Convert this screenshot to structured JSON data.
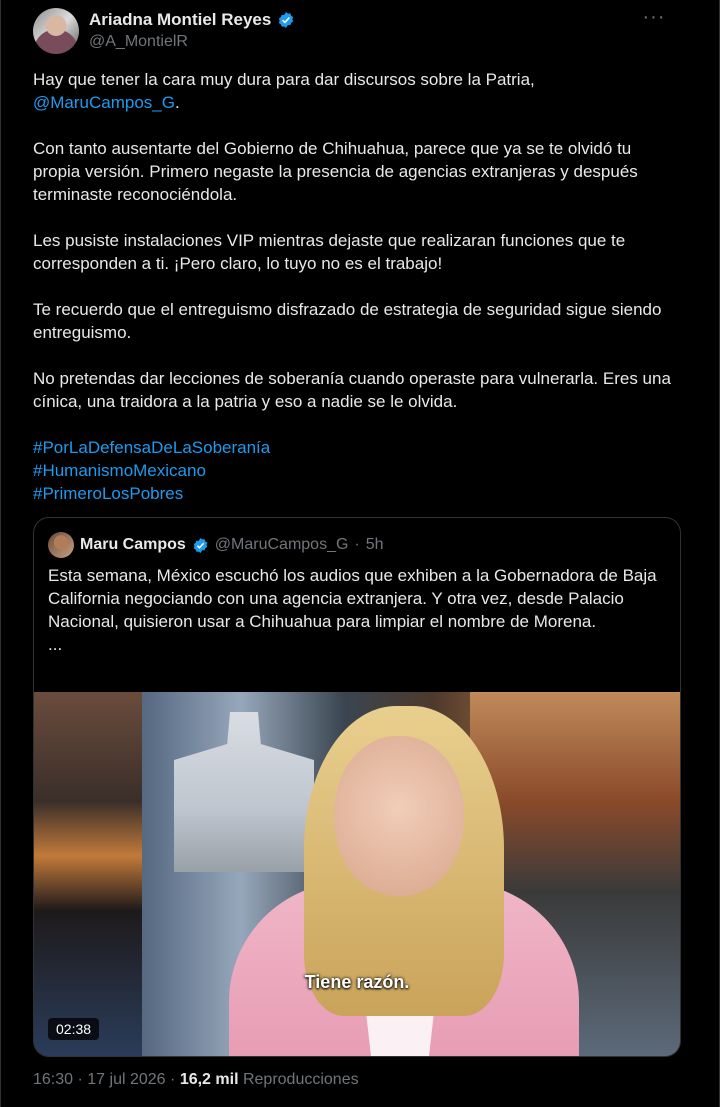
{
  "author": {
    "name": "Ariadna Montiel Reyes",
    "handle": "@A_MontielR",
    "more_label": "···"
  },
  "tweet": {
    "p1_text": "Hay que tener la cara muy dura para dar discursos sobre la Patria,",
    "p1_mention": "@MaruCampos_G",
    "p1_end": ".",
    "p2": "Con tanto ausentarte del Gobierno de Chihuahua, parece que ya se te olvidó tu propia versión. Primero negaste la presencia de agencias extranjeras y después terminaste reconociéndola.",
    "p3": "Les pusiste instalaciones VIP mientras dejaste que realizaran funciones que te corresponden a ti. ¡Pero claro, lo tuyo no es el trabajo!",
    "p4": "Te recuerdo que el  entreguismo disfrazado de estrategia de seguridad sigue siendo entreguismo.",
    "p5": "No pretendas dar lecciones de soberanía cuando operaste para vulnerarla. Eres una cínica, una traidora a la patria y eso a nadie se le olvida.",
    "hashtags": [
      "#PorLaDefensaDeLaSoberanía",
      "#HumanismoMexicano",
      "#PrimeroLosPobres"
    ]
  },
  "quote": {
    "name": "Maru Campos",
    "handle": "@MaruCampos_G",
    "separator": "·",
    "time": "5h",
    "text": "Esta semana, México escuchó los audios que exhiben a la Gobernadora de Baja California negociando con una agencia extranjera. Y otra vez, desde Palacio Nacional, quisieron usar a Chihuahua para limpiar el nombre de Morena.",
    "ellipsis": "...",
    "video_caption": "Tiene razón.",
    "video_duration": "02:38"
  },
  "footer": {
    "time": "16:30",
    "sep1": "·",
    "date": "17 jul 2026",
    "sep2": "·",
    "views_count": "16,2 mil",
    "views_label": "Reproducciones"
  },
  "colors": {
    "background": "#000000",
    "text": "#e7e9ea",
    "muted": "#71767b",
    "link": "#1d9bf0",
    "verified": "#1d9bf0"
  }
}
